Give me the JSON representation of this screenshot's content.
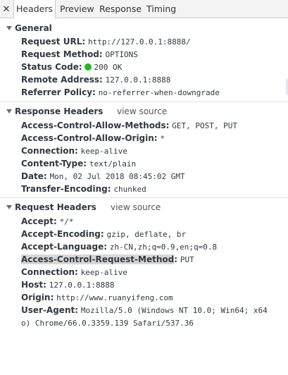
{
  "tabs": {
    "close_icon": "close-icon",
    "items": [
      "Headers",
      "Preview",
      "Response",
      "Timing"
    ],
    "active": "Headers"
  },
  "general": {
    "title": "General",
    "rows": [
      {
        "key": "Request URL:",
        "value": "http://127.0.0.1:8888/"
      },
      {
        "key": "Request Method:",
        "value": "OPTIONS"
      },
      {
        "key": "Status Code:",
        "value": "200 OK"
      },
      {
        "key": "Remote Address:",
        "value": "127.0.0.1:8888"
      },
      {
        "key": "Referrer Policy:",
        "value": "no-referrer-when-downgrade"
      }
    ],
    "status_color": "#1fb81f"
  },
  "response_headers": {
    "title": "Response Headers",
    "view_source": "view source",
    "rows": [
      {
        "key": "Access-Control-Allow-Methods:",
        "value": "GET, POST, PUT"
      },
      {
        "key": "Access-Control-Allow-Origin:",
        "value": "*"
      },
      {
        "key": "Connection:",
        "value": "keep-alive"
      },
      {
        "key": "Content-Type:",
        "value": "text/plain"
      },
      {
        "key": "Date:",
        "value": "Mon, 02 Jul 2018 08:45:02 GMT"
      },
      {
        "key": "Transfer-Encoding:",
        "value": "chunked"
      }
    ]
  },
  "request_headers": {
    "title": "Request Headers",
    "view_source": "view source",
    "rows": [
      {
        "key": "Accept:",
        "value": "*/*"
      },
      {
        "key": "Accept-Encoding:",
        "value": "gzip, deflate, br"
      },
      {
        "key": "Accept-Language:",
        "value": "zh-CN,zh;q=0.9,en;q=0.8"
      },
      {
        "key": "Access-Control-Request-Method",
        "value": "PUT"
      },
      {
        "key": "Host:",
        "value": "127.0.0.1:8888"
      },
      {
        "key": "Origin:",
        "value": "http://www.ruanyifeng.com"
      },
      {
        "key": "User-Agent:",
        "value": "Mozilla/5.0 (Windows NT 10.0; Win64; x64"
      },
      {
        "key": "Connection:",
        "value": "keep-alive"
      }
    ],
    "user_agent_wrap": "o) Chrome/66.0.3359.139 Safari/537.36",
    "highlight_color": "#d7d7d7"
  }
}
